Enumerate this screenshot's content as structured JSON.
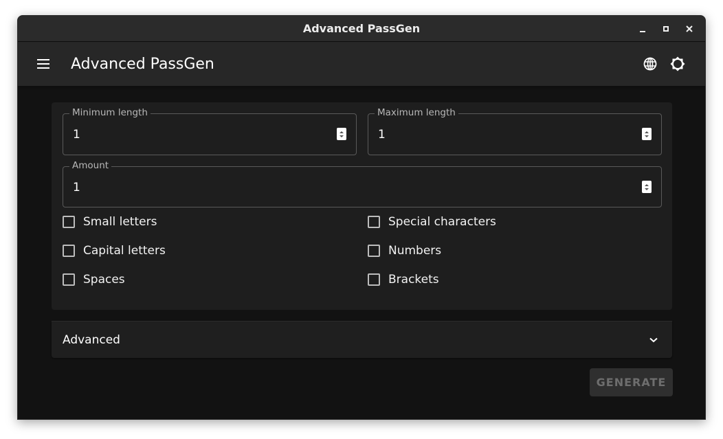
{
  "window": {
    "title": "Advanced PassGen",
    "controls": {
      "minimize": "minimize-icon",
      "maximize": "maximize-icon",
      "close": "close-icon"
    }
  },
  "appbar": {
    "title": "Advanced PassGen",
    "menu_icon": "hamburger-menu-icon",
    "actions": [
      {
        "name": "language",
        "icon": "globe-icon"
      },
      {
        "name": "theme",
        "icon": "brightness-icon"
      }
    ]
  },
  "form": {
    "min_length": {
      "label": "Minimum length",
      "value": "1"
    },
    "max_length": {
      "label": "Maximum length",
      "value": "1"
    },
    "amount": {
      "label": "Amount",
      "value": "1"
    },
    "options": [
      {
        "label": "Small letters",
        "checked": false
      },
      {
        "label": "Special characters",
        "checked": false
      },
      {
        "label": "Capital letters",
        "checked": false
      },
      {
        "label": "Numbers",
        "checked": false
      },
      {
        "label": "Spaces",
        "checked": false
      },
      {
        "label": "Brackets",
        "checked": false
      }
    ]
  },
  "advanced": {
    "title": "Advanced",
    "expanded": false
  },
  "actions": {
    "generate_label": "GENERATE",
    "generate_disabled": true
  },
  "colors": {
    "background": "#121212",
    "surface": "#1e1e1e",
    "appbar": "#272727",
    "titlebar": "#2b2b2b",
    "disabled_button": "#2f2f2f",
    "disabled_text": "#6e6e6e"
  }
}
